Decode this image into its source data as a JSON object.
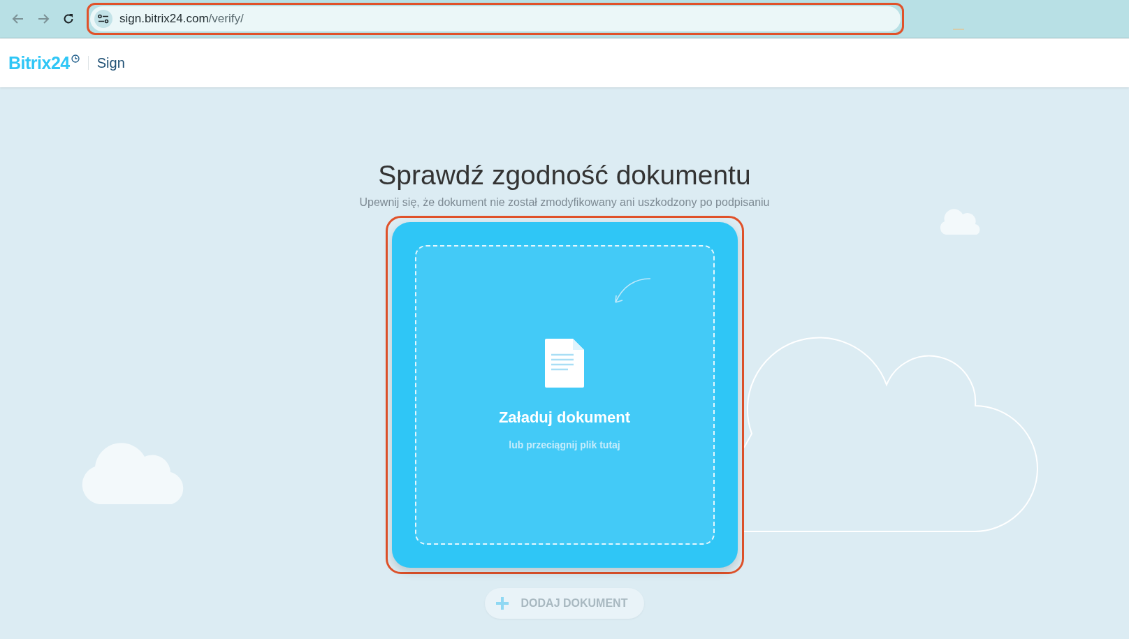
{
  "browser": {
    "url_host": "sign.bitrix24.com",
    "url_path": "/verify/",
    "url_highlighted": true
  },
  "header": {
    "logo": "Bitrix24",
    "product": "Sign"
  },
  "page": {
    "title": "Sprawdź zgodność dokumentu",
    "subtitle": "Upewnij się, że dokument nie został zmodyfikowany ani uszkodzony po podpisaniu",
    "upload": {
      "title": "Załaduj dokument",
      "hint": "lub przeciągnij plik tutaj",
      "highlighted": true
    },
    "add_button": {
      "label": "DODAJ DOKUMENT",
      "disabled": true
    }
  }
}
